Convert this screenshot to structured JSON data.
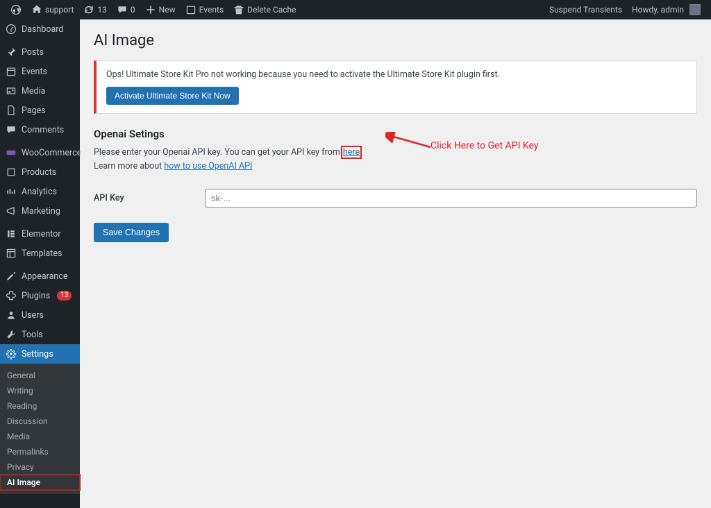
{
  "adminBar": {
    "siteName": "support",
    "updates": "13",
    "comments": "0",
    "new": "New",
    "events": "Events",
    "deleteCache": "Delete Cache",
    "suspendTransients": "Suspend Transients",
    "howdy": "Howdy, admin"
  },
  "sidebar": {
    "dashboard": "Dashboard",
    "posts": "Posts",
    "events": "Events",
    "media": "Media",
    "pages": "Pages",
    "comments": "Comments",
    "woocommerce": "WooCommerce",
    "products": "Products",
    "analytics": "Analytics",
    "marketing": "Marketing",
    "elementor": "Elementor",
    "templates": "Templates",
    "appearance": "Appearance",
    "plugins": "Plugins",
    "pluginsBadge": "13",
    "users": "Users",
    "tools": "Tools",
    "settings": "Settings",
    "sub": {
      "general": "General",
      "writing": "Writing",
      "reading": "Reading",
      "discussion": "Discussion",
      "media": "Media",
      "permalinks": "Permalinks",
      "privacy": "Privacy",
      "aiImage": "AI Image"
    }
  },
  "main": {
    "title": "AI Image",
    "noticeText": "Ops! Ultimate Store Kit Pro not working because you need to activate the Ultimate Store Kit plugin first.",
    "noticeButton": "Activate Ultimate Store Kit Now",
    "sectionHeading": "Openai Setings",
    "helpText1": "Please enter your Openai API key. You can get your API key from ",
    "helpHereLink": "here",
    "helpText1b": ".",
    "helpText2a": "Learn more about ",
    "helpLearnLink": "how to use OpenAI API",
    "apiKeyLabel": "API Key",
    "apiKeyPlaceholder": "sk-...",
    "saveButton": "Save Changes",
    "annotation": "Click Here to Get API Key"
  }
}
